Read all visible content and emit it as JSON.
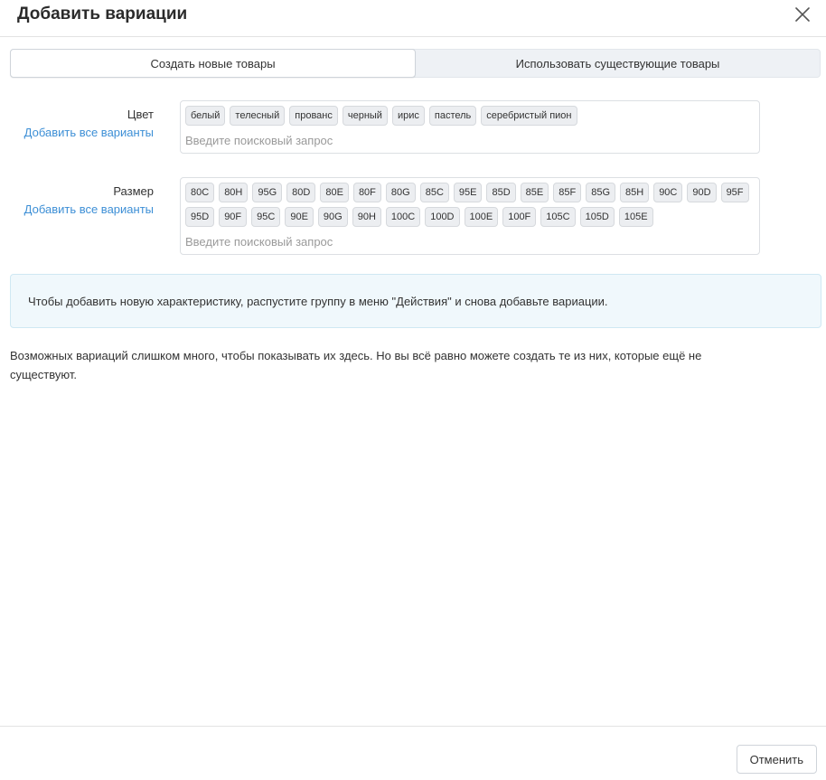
{
  "dialog": {
    "title": "Добавить вариации"
  },
  "tabs": [
    {
      "label": "Создать новые товары",
      "active": true
    },
    {
      "label": "Использовать существующие товары",
      "active": false
    }
  ],
  "attributes": [
    {
      "label": "Цвет",
      "add_all": "Добавить все варианты",
      "placeholder": "Введите поисковый запрос",
      "values": [
        "белый",
        "телесный",
        "прованс",
        "черный",
        "ирис",
        "пастель",
        "серебристый пион"
      ]
    },
    {
      "label": "Размер",
      "add_all": "Добавить все варианты",
      "placeholder": "Введите поисковый запрос",
      "values": [
        "80C",
        "80H",
        "95G",
        "80D",
        "80E",
        "80F",
        "80G",
        "85C",
        "95E",
        "85D",
        "85E",
        "85F",
        "85G",
        "85H",
        "90C",
        "90D",
        "95F",
        "95D",
        "90F",
        "95C",
        "90E",
        "90G",
        "90H",
        "100C",
        "100D",
        "100E",
        "100F",
        "105C",
        "105D",
        "105E"
      ]
    }
  ],
  "notice": "Чтобы добавить новую характеристику, распустите группу в меню \"Действия\" и снова добавьте вариации.",
  "info": "Возможных вариаций слишком много, чтобы показывать их здесь. Но вы всё равно можете создать те из них, которые ещё не существуют.",
  "footer": {
    "cancel_label": "Отменить"
  },
  "icons": {
    "close": "close-icon"
  },
  "colors": {
    "link": "#3d8fd6",
    "notice_bg": "#f0f8fc",
    "tab_bg": "#eef1f5"
  }
}
